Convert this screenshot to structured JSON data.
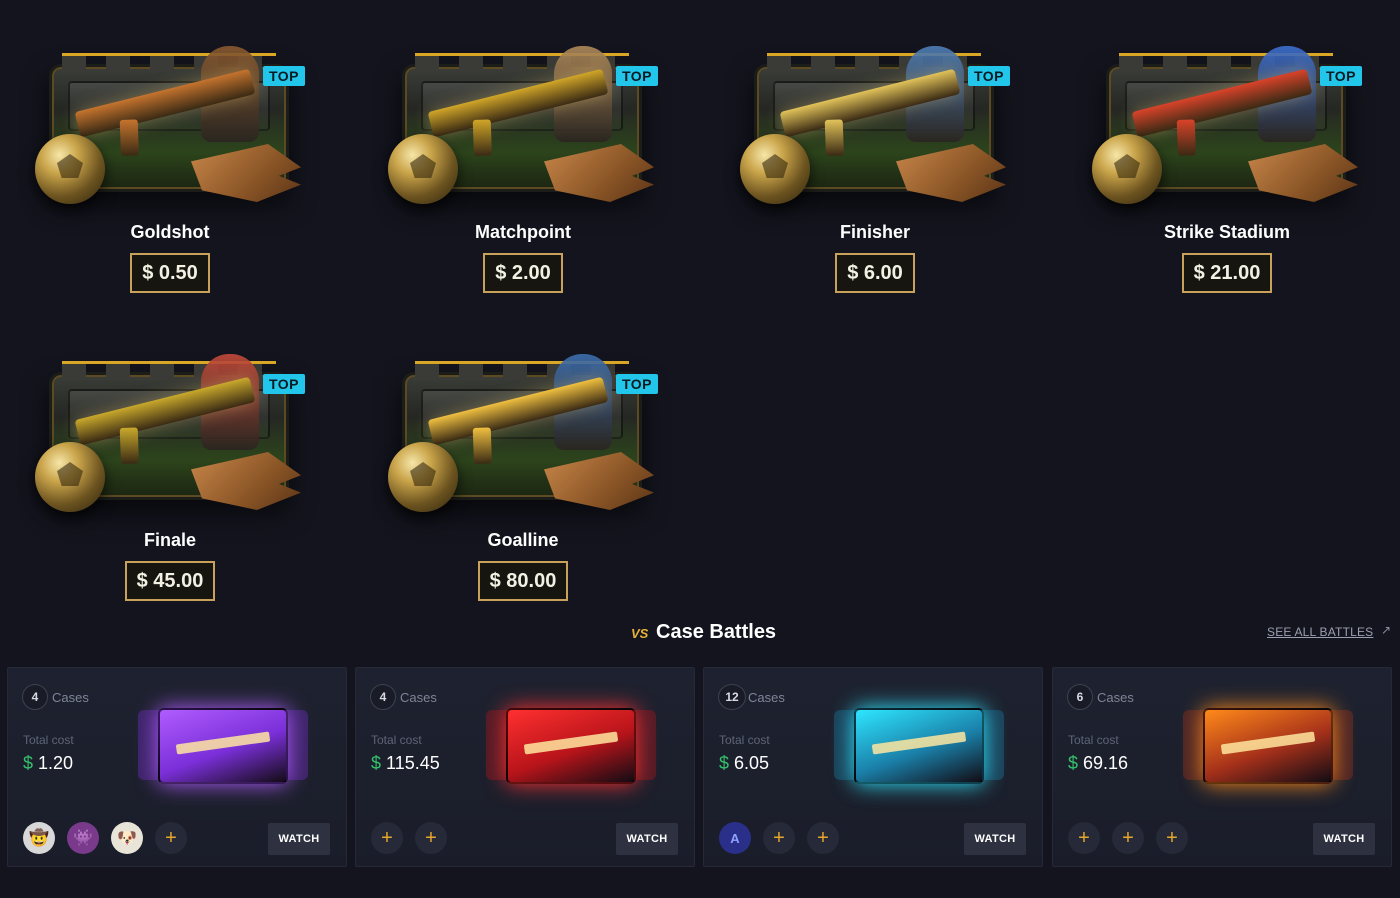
{
  "cases": [
    {
      "name": "Goldshot",
      "price": "$ 0.50",
      "badge": "TOP",
      "weapon_color": "#c6742e",
      "figure_color": "#8a5a30"
    },
    {
      "name": "Matchpoint",
      "price": "$ 2.00",
      "badge": "TOP",
      "weapon_color": "#d1a628",
      "figure_color": "#b08a5a"
    },
    {
      "name": "Finisher",
      "price": "$ 6.00",
      "badge": "TOP",
      "weapon_color": "#e2c35a",
      "figure_color": "#4f7fb8"
    },
    {
      "name": "Strike Stadium",
      "price": "$ 21.00",
      "badge": "TOP",
      "weapon_color": "#d9432a",
      "figure_color": "#3c6fd0"
    },
    {
      "name": "Finale",
      "price": "$ 45.00",
      "badge": "TOP",
      "weapon_color": "#c9a92c",
      "figure_color": "#c44a3a"
    },
    {
      "name": "Goalline",
      "price": "$ 80.00",
      "badge": "TOP",
      "weapon_color": "#f0c040",
      "figure_color": "#3d6fb0"
    }
  ],
  "battles_section": {
    "vs_label": "VS",
    "title": "Case Battles",
    "see_all": "SEE ALL BATTLES",
    "see_all_arrow": "↗"
  },
  "battles": [
    {
      "cases_count": "4",
      "cases_label": "Cases",
      "total_label": "Total cost",
      "currency": "$",
      "total": "1.20",
      "case_color": "#7a2fd8",
      "case_glow": "#b05cff",
      "players": [
        {
          "type": "avatar",
          "icon": "cowboy-avatar",
          "glyph": "🤠",
          "color": "#d8d8d8"
        },
        {
          "type": "avatar",
          "icon": "creature-avatar",
          "glyph": "👾",
          "color": "#7a3a8c"
        },
        {
          "type": "avatar",
          "icon": "dog-avatar",
          "glyph": "🐶",
          "color": "#e8e4d8"
        },
        {
          "type": "slot",
          "glyph": "+"
        }
      ],
      "watch": "WATCH"
    },
    {
      "cases_count": "4",
      "cases_label": "Cases",
      "total_label": "Total cost",
      "currency": "$",
      "total": "115.45",
      "case_color": "#b8141a",
      "case_glow": "#ff3030",
      "players": [
        {
          "type": "slot",
          "glyph": "+"
        },
        {
          "type": "slot",
          "glyph": "+"
        }
      ],
      "watch": "WATCH"
    },
    {
      "cases_count": "12",
      "cases_label": "Cases",
      "total_label": "Total cost",
      "currency": "$",
      "total": "6.05",
      "case_color": "#1a7fa8",
      "case_glow": "#2ee6ff",
      "players": [
        {
          "type": "avatar",
          "icon": "arakoz-avatar",
          "glyph": "A",
          "color": "#2a2f8a"
        },
        {
          "type": "slot",
          "glyph": "+"
        },
        {
          "type": "slot",
          "glyph": "+"
        }
      ],
      "watch": "WATCH"
    },
    {
      "cases_count": "6",
      "cases_label": "Cases",
      "total_label": "Total cost",
      "currency": "$",
      "total": "69.16",
      "case_color": "#a5301a",
      "case_glow": "#ff8a1a",
      "players": [
        {
          "type": "slot",
          "glyph": "+"
        },
        {
          "type": "slot",
          "glyph": "+"
        },
        {
          "type": "slot",
          "glyph": "+"
        }
      ],
      "watch": "WATCH"
    }
  ],
  "colors": {
    "background": "#13141d",
    "badge": "#21c6ea",
    "price_border": "#c8a15a",
    "currency_green": "#35c26c",
    "accent_gold": "#e6a72a"
  }
}
